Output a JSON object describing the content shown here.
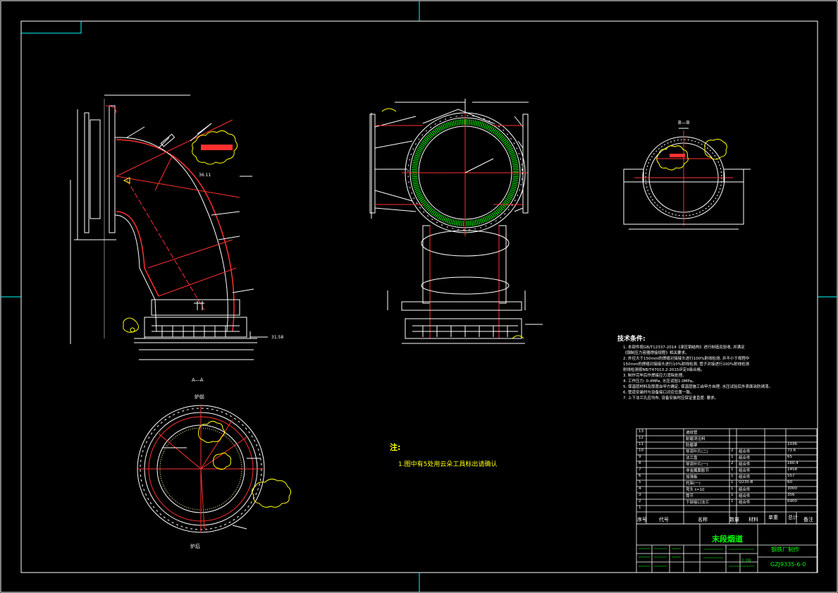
{
  "technical_requirements": {
    "title": "技术条件:",
    "items": [
      "1. 本部件按GB/T12337-2014《承压钢结构》进行制造及验收, 并满足",
      "   《钢制压力容器焊接规程》相关要求。",
      "2. 外径大于150mm的焊缝对接接头进行100%射线检测, 并不小于规程中",
      "   150mm的焊缝对接接头进行10%射线检测, 管子对接进行100%射线检测",
      "   射线检测按NB/T47013.2-2015评定II级合格。",
      "3. 制作完毕后作焊接应力消除处理。",
      "4. 工作压力: 0.4MPa, 水压试验1.0MPa。",
      "5. 保温层材料及厚度由甲方确定, 保温层施工由甲方自理, 水压试验后外表面涂防锈漆。",
      "6. 管道安装时与设备接口对应位置一致。",
      "7. 上下法兰孔应均布, 设备安装时应保证垂直度: 要求。"
    ]
  },
  "note": {
    "title": "注:",
    "body": "1.图中有5处用云朵工具标出请确认"
  },
  "views": {
    "section_aa": "A—A",
    "section_bb": "B—B",
    "aa_top_label": "炉前",
    "aa_bottom_label": "炉后",
    "side_dim": "36.11",
    "bottom_dim": "31.58"
  },
  "parts_table": {
    "headers": [
      "序号",
      "代号",
      "名称",
      "数量",
      "材料",
      "单重",
      "总计",
      "备注"
    ],
    "rows": [
      {
        "no": "13",
        "name": "波纹管",
        "qty": "",
        "mat": "",
        "note": ""
      },
      {
        "no": "12",
        "name": "耐磨浇注料",
        "qty": "",
        "mat": "",
        "note": ""
      },
      {
        "no": "11",
        "name": "防磨罩",
        "qty": "",
        "mat": "",
        "note": "1036"
      },
      {
        "no": "10",
        "name": "导流叶片(二)",
        "qty": "2",
        "mat": "组合件",
        "note": "71.6"
      },
      {
        "no": "9",
        "name": "法兰盘",
        "qty": "1",
        "mat": "组合件",
        "note": "65"
      },
      {
        "no": "8",
        "name": "导流叶片(一)",
        "qty": "2",
        "mat": "组合件",
        "note": "160.4"
      },
      {
        "no": "7",
        "name": "非金属膨胀节",
        "qty": "1",
        "mat": "组合件",
        "note": "1458"
      },
      {
        "no": "6",
        "name": "加强板",
        "qty": "1",
        "mat": "组合件",
        "note": "557"
      },
      {
        "no": "5",
        "name": "托架(一)",
        "qty": "1",
        "mat": "Q235-B",
        "note": "60"
      },
      {
        "no": "4",
        "name": "弯头 t=10",
        "qty": "1",
        "mat": "组合件",
        "note": "3000"
      },
      {
        "no": "3",
        "name": "筒节",
        "qty": "1",
        "mat": "组合件",
        "note": "356"
      },
      {
        "no": "2",
        "name": "下部接口法兰",
        "qty": "1",
        "mat": "组合件",
        "note": "6900"
      },
      {
        "no": "1",
        "name": "",
        "qty": "",
        "mat": "",
        "note": ""
      }
    ]
  },
  "title_block": {
    "drawing_title": "末段烟道",
    "company": "钢铁厂制作",
    "drawing_code": "GZJ9335-6-0",
    "scale": "1:20"
  },
  "colors": {
    "background": "#000000",
    "line_white": "#ffffff",
    "line_red": "#ff3030",
    "line_green": "#00ff00",
    "line_yellow": "#ffff00",
    "line_cyan": "#00ffff"
  }
}
